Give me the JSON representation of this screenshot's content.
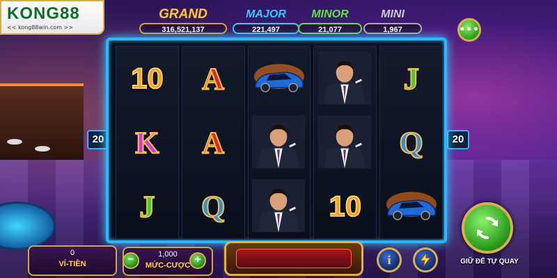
{
  "brand": {
    "logo_text": "KONG88",
    "url": "<< kong88win.com >>"
  },
  "jackpots": {
    "grand": {
      "label": "GRAND",
      "value": "316,521,137"
    },
    "major": {
      "label": "MAJOR",
      "value": "221,497"
    },
    "minor": {
      "label": "MINOR",
      "value": "21,077"
    },
    "mini": {
      "label": "MINI",
      "value": "1,967"
    }
  },
  "menu": {
    "label": "•••"
  },
  "paylines": {
    "left": "20",
    "right": "20"
  },
  "reels": [
    [
      "10",
      "K",
      "J"
    ],
    [
      "A",
      "A",
      "Q"
    ],
    [
      "car",
      "man",
      "man"
    ],
    [
      "man",
      "man",
      "10"
    ],
    [
      "J",
      "Q",
      "car"
    ]
  ],
  "balance": {
    "value": "0",
    "label": "VÍ-TIỀN"
  },
  "bet": {
    "value": "1,000",
    "label": "MỨC-CƯỢC",
    "minus": "−",
    "plus": "+"
  },
  "buttons": {
    "info": "i",
    "auto_spin_label": "GIỮ ĐỂ TỰ QUAY"
  },
  "colors": {
    "frame": "#2fb4ff",
    "gold": "#d8b050",
    "green_button": "#2c9c1f"
  }
}
